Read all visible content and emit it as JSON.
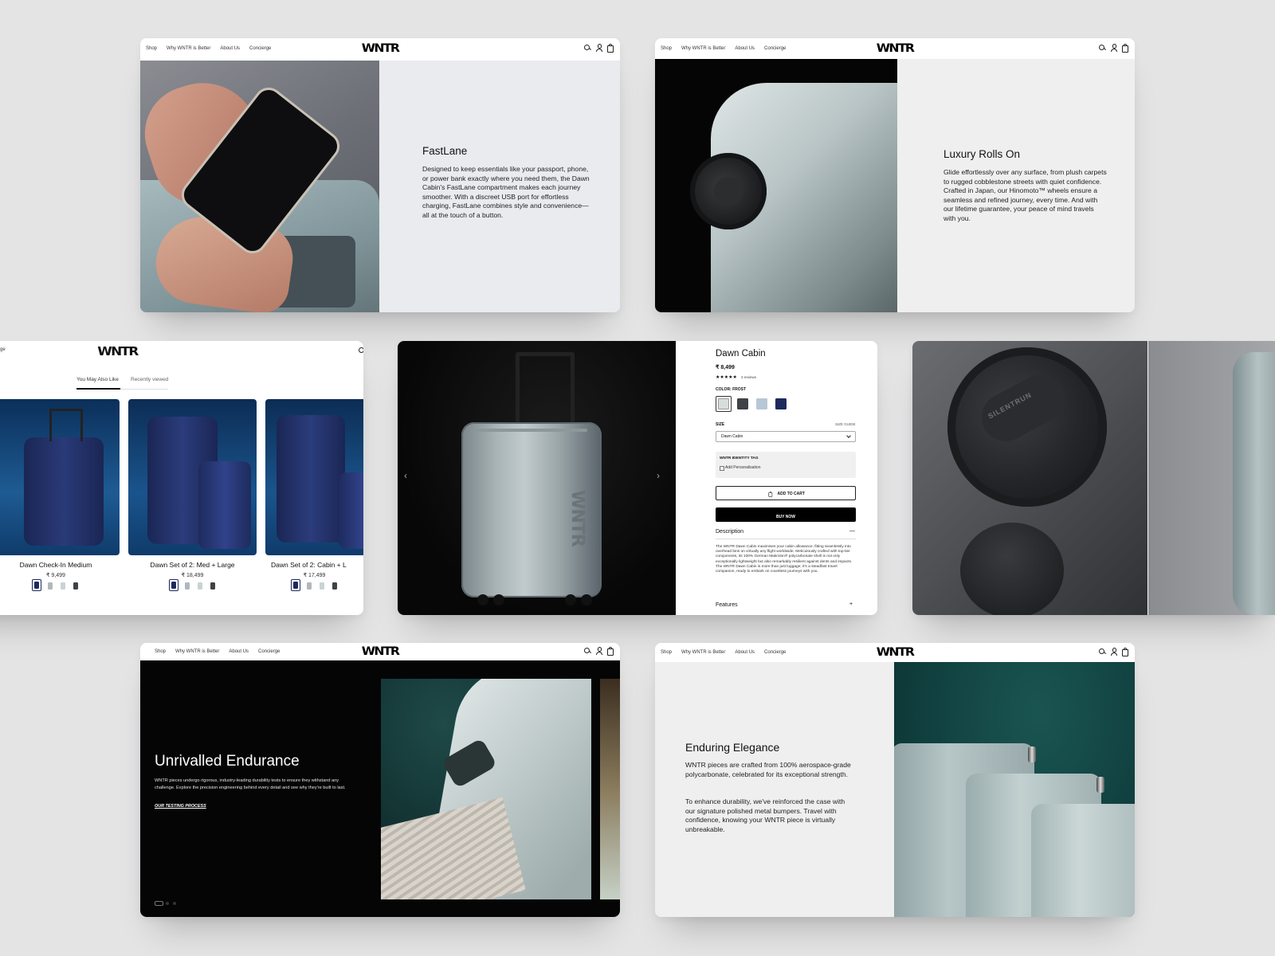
{
  "nav": {
    "links": [
      "Shop",
      "Why WNTR is Better",
      "About Us",
      "Concierge"
    ],
    "logo": "WNTR",
    "left_fragment": "ge"
  },
  "fastlane": {
    "title": "FastLane",
    "body": "Designed to keep essentials like your passport, phone, or power bank exactly where you need them, the Dawn Cabin's FastLane compartment makes each journey smoother. With a discreet USB port for effortless charging, FastLane combines style and convenience—all at the touch of a button."
  },
  "luxury": {
    "title": "Luxury Rolls On",
    "body": "Glide effortlessly over any surface, from plush carpets to rugged cobblestone streets with quiet confidence. Crafted in Japan, our Hinomoto™ wheels ensure a seamless and refined journey, every time. And with our lifetime guarantee, your peace of mind travels with you."
  },
  "recs": {
    "tabs": [
      "You May Also Like",
      "Recently viewed"
    ],
    "products": [
      {
        "name": "Dawn Check-In Medium",
        "price": "₹ 9,499"
      },
      {
        "name": "Dawn Set of 2: Med + Large",
        "price": "₹ 18,499"
      },
      {
        "name": "Dawn Set of 2: Cabin + L",
        "price": "₹ 17,499"
      }
    ]
  },
  "product": {
    "name": "Dawn Cabin",
    "price": "₹ 8,499",
    "stars": "★★★★★",
    "reviews": "3 reviews",
    "color_label": "COLOR: FROST",
    "size_label": "SIZE",
    "size_guide": "SIZE GUIDE",
    "size_value": "Dawn Cabin",
    "tag_title": "WNTR IDENTITY TAG",
    "tag_option": "Add Personalisation",
    "add_to_cart": "ADD TO CART",
    "buy_now": "BUY NOW",
    "description_label": "Description",
    "description_toggle": "—",
    "description": "The WNTR Dawn Cabin maximises your cabin allowance, fitting seamlessly into overhead bins on virtually any flight worldwide. Meticulously crafted with top-tier components, its 100% German Makrolon® polycarbonate shell is not only exceptionally lightweight but also remarkably resilient against dents and impacts. The WNTR Dawn Cabin is more than just luggage; it's a steadfast travel companion, ready to embark on countless journeys with you.",
    "features_label": "Features",
    "features_toggle": "+",
    "arrow_left": "‹",
    "arrow_right": "›",
    "suitcase_brand": "WNTR"
  },
  "wheel": {
    "engraving": "SILENTRUN"
  },
  "endurance": {
    "title": "Unrivalled Endurance",
    "body": "WNTR pieces undergo rigorous, industry-leading durability tests to ensure they withstand any challenge. Explore the precision engineering behind every detail and see why they're built to last.",
    "link": "OUR TESTING PROCESS"
  },
  "elegance": {
    "title": "Enduring Elegance",
    "p1": "WNTR pieces are crafted from 100% aerospace-grade polycarbonate, celebrated for its exceptional strength.",
    "p2": "To enhance durability, we've reinforced the case with our signature polished metal bumpers. Travel with confidence, knowing your WNTR piece is virtually unbreakable."
  },
  "colors": {
    "navy": "#1c2a5c",
    "frost": "#c9d3d4",
    "graphite": "#3f4246",
    "black": "#000000",
    "teal": "#12403f",
    "panel_grey": "#efefef"
  }
}
